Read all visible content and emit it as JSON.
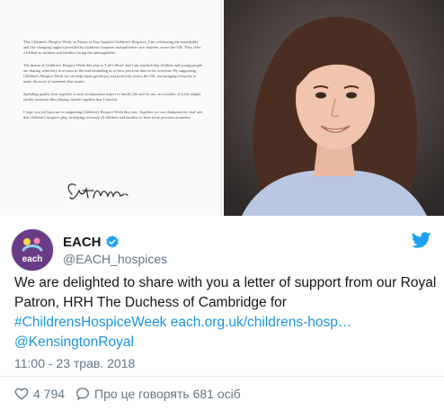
{
  "letter": {
    "paragraphs": [
      "This Children's Hospice Week, as Patron of East Anglia's Children's Hospices, I am celebrating the remarkable and life-changing support provided by children's hospices and palliative care charities across the UK. They offer a lifeline to children and families facing the unimaginable.",
      "The theme of Children's Hospice Week this year is 'Life's Short' and I am touched that children and young people are sharing what they love most in life and reminding us of how precious time is for everyone. By supporting Children's Hospice Week we can help them spread joy and positivity across the UK, encouraging everyone to make the most of moments that matter.",
      "Spending quality time together is such an important aspect of family life and for me, as a mother, it is the simple family moments like playing outside together that I cherish.",
      "I hope you will join me in supporting Children's Hospice Week this year. Together we can champion the vital role that children's hospices play in helping seriously ill children and families to have more precious moments."
    ]
  },
  "account": {
    "display_name": "EACH",
    "handle": "@EACH_hospices",
    "avatar_text": "each"
  },
  "tweet": {
    "text_plain": "We are delighted to share with you a letter of support from our Royal Patron, HRH The Duchess of Cambridge for ",
    "hashtag": "#ChildrensHospiceWeek",
    "url": "each.org.uk/childrens-hosp…",
    "mention": "@KensingtonRoyal",
    "timestamp": "11:00 - 23 трав. 2018"
  },
  "footer": {
    "likes": "4 794",
    "replies_label": "Про це говорять 681 осіб"
  },
  "colors": {
    "link": "#1b95e0",
    "twitter_blue": "#1da1f2",
    "brand_purple": "#6a3b86"
  }
}
